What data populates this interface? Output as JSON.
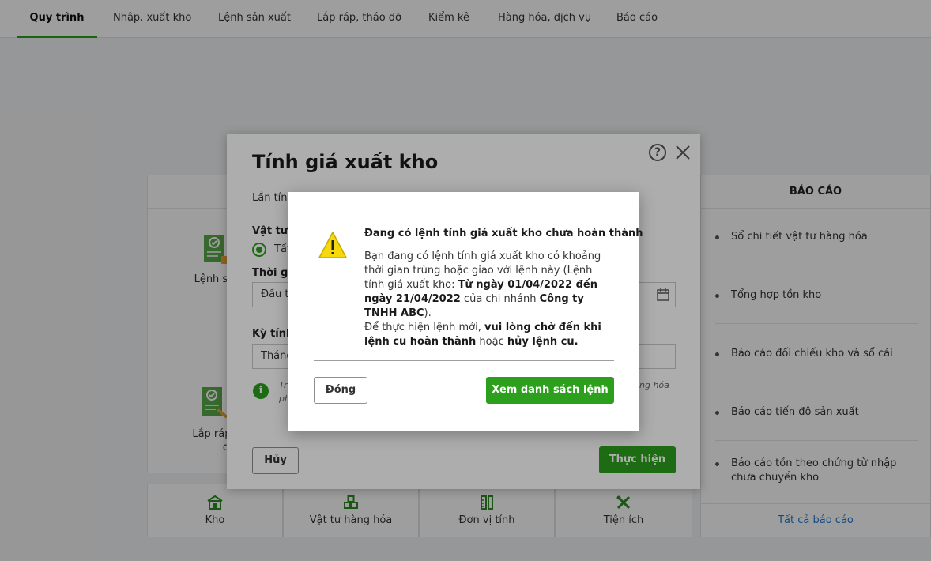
{
  "tabs": [
    {
      "label": "Quy trình",
      "active": true
    },
    {
      "label": "Nhập, xuất kho",
      "active": false
    },
    {
      "label": "Lệnh sản xuất",
      "active": false
    },
    {
      "label": "Lắp ráp, tháo dỡ",
      "active": false
    },
    {
      "label": "Kiểm kê",
      "active": false
    },
    {
      "label": "Hàng hóa, dịch vụ",
      "active": false
    },
    {
      "label": "Báo cáo",
      "active": false
    }
  ],
  "flow": {
    "card1_label": "Lệnh sản",
    "card2_label_line1": "Lắp ráp,",
    "card2_label_line2": "dỡ"
  },
  "reports": {
    "header": "BÁO CÁO",
    "items": [
      "Sổ chi tiết vật tư hàng hóa",
      "Tổng hợp tồn kho",
      "Báo cáo đối chiếu kho và sổ cái",
      "Báo cáo tiến độ sản xuất",
      "Báo cáo tồn theo chứng từ nhập chưa chuyển kho"
    ],
    "all_link": "Tất cả báo cáo"
  },
  "shortcuts": [
    {
      "label": "Kho",
      "icon": "warehouse-icon"
    },
    {
      "label": "Vật tư hàng hóa",
      "icon": "goods-icon"
    },
    {
      "label": "Đơn vị tính",
      "icon": "ruler-icon"
    },
    {
      "label": "Tiện ích",
      "icon": "tools-icon"
    }
  ],
  "dialog": {
    "title": "Tính giá xuất kho",
    "last_run_label": "Lần tính",
    "materials_label": "Vật tư h",
    "radio_all_label": "Tất",
    "period_label": "Thời gia",
    "period_value": "Đầu th",
    "calc_period_label": "Kỳ tính",
    "calc_period_value": "Tháng",
    "info_line1_left": "Tr",
    "info_line2_left": "ph",
    "info_line1_right": "ng hóa",
    "cancel_label": "Hủy",
    "execute_label": "Thực hiện"
  },
  "alert": {
    "title": "Đang có lệnh tính giá xuất kho chưa hoàn thành",
    "body_1": "Bạn đang có lệnh tính giá xuất kho có khoảng thời gian trùng hoặc giao với lệnh này (Lệnh tính giá xuất kho: ",
    "body_range": "Từ ngày 01/04/2022 đến ngày 21/04/2022",
    "body_2": " của chi nhánh ",
    "body_company": "Công ty TNHH ABC",
    "body_3": ").",
    "body_4": "Để thực hiện lệnh mới, ",
    "body_wait": "vui lòng chờ đến khi lệnh cũ hoàn thành",
    "body_5": " hoặc ",
    "body_cancel_old": "hủy lệnh cũ.",
    "close_label": "Đóng",
    "view_list_label": "Xem danh sách lệnh"
  },
  "colors": {
    "accent": "#2ca01c",
    "link": "#1f7ad1",
    "warning": "#f5d90a"
  }
}
